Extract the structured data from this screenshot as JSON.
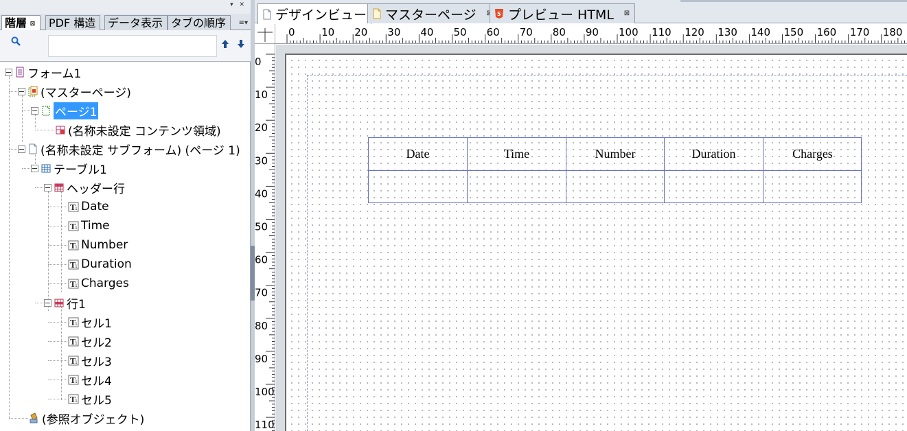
{
  "left_panel": {
    "tabs": [
      {
        "label": "階層",
        "active": true
      },
      {
        "label": "PDF 構造"
      },
      {
        "label": "データ表示"
      },
      {
        "label": "タブの順序"
      }
    ],
    "search": {
      "value": "",
      "placeholder": ""
    },
    "tree": [
      {
        "label": "フォーム1",
        "icon": "form-icon"
      },
      {
        "label": "(マスターページ)",
        "icon": "master-pages-icon"
      },
      {
        "label": "ページ1",
        "icon": "master-page-icon",
        "selected": true
      },
      {
        "label": "(名称未設定 コンテンツ領域)",
        "icon": "content-area-icon"
      },
      {
        "label": "(名称未設定 サブフォーム) (ページ 1)",
        "icon": "subform-icon"
      },
      {
        "label": "テーブル1",
        "icon": "table-icon"
      },
      {
        "label": "ヘッダー行",
        "icon": "header-row-icon"
      },
      {
        "label": "Date",
        "icon": "text-field-icon"
      },
      {
        "label": "Time",
        "icon": "text-field-icon"
      },
      {
        "label": "Number",
        "icon": "text-field-icon"
      },
      {
        "label": "Duration",
        "icon": "text-field-icon"
      },
      {
        "label": "Charges",
        "icon": "text-field-icon"
      },
      {
        "label": "行1",
        "icon": "row-icon"
      },
      {
        "label": "セル1",
        "icon": "text-field-icon"
      },
      {
        "label": "セル2",
        "icon": "text-field-icon"
      },
      {
        "label": "セル3",
        "icon": "text-field-icon"
      },
      {
        "label": "セル4",
        "icon": "text-field-icon"
      },
      {
        "label": "セル5",
        "icon": "text-field-icon"
      },
      {
        "label": "(参照オブジェクト)",
        "icon": "referenced-objects-icon"
      }
    ]
  },
  "doc_tabs": [
    {
      "label": "デザインビュー",
      "active": true
    },
    {
      "label": "マスターページ"
    },
    {
      "label": "プレビュー HTML"
    }
  ],
  "ruler": {
    "horizontal": [
      "0",
      "10",
      "20",
      "30",
      "40",
      "50",
      "60",
      "70",
      "80",
      "90",
      "100",
      "110",
      "120",
      "130",
      "140",
      "150",
      "160",
      "170",
      "180"
    ],
    "vertical": [
      "0",
      "10",
      "20",
      "30",
      "40",
      "50",
      "60",
      "70",
      "80",
      "90",
      "100",
      "110"
    ]
  },
  "table": {
    "headers": [
      "Date",
      "Time",
      "Number",
      "Duration",
      "Charges"
    ],
    "row1": [
      "",
      "",
      "",
      "",
      ""
    ]
  },
  "colors": {
    "selection": "#3399ff",
    "table_border": "#6a73c9",
    "accent_html": "#e44d26"
  }
}
